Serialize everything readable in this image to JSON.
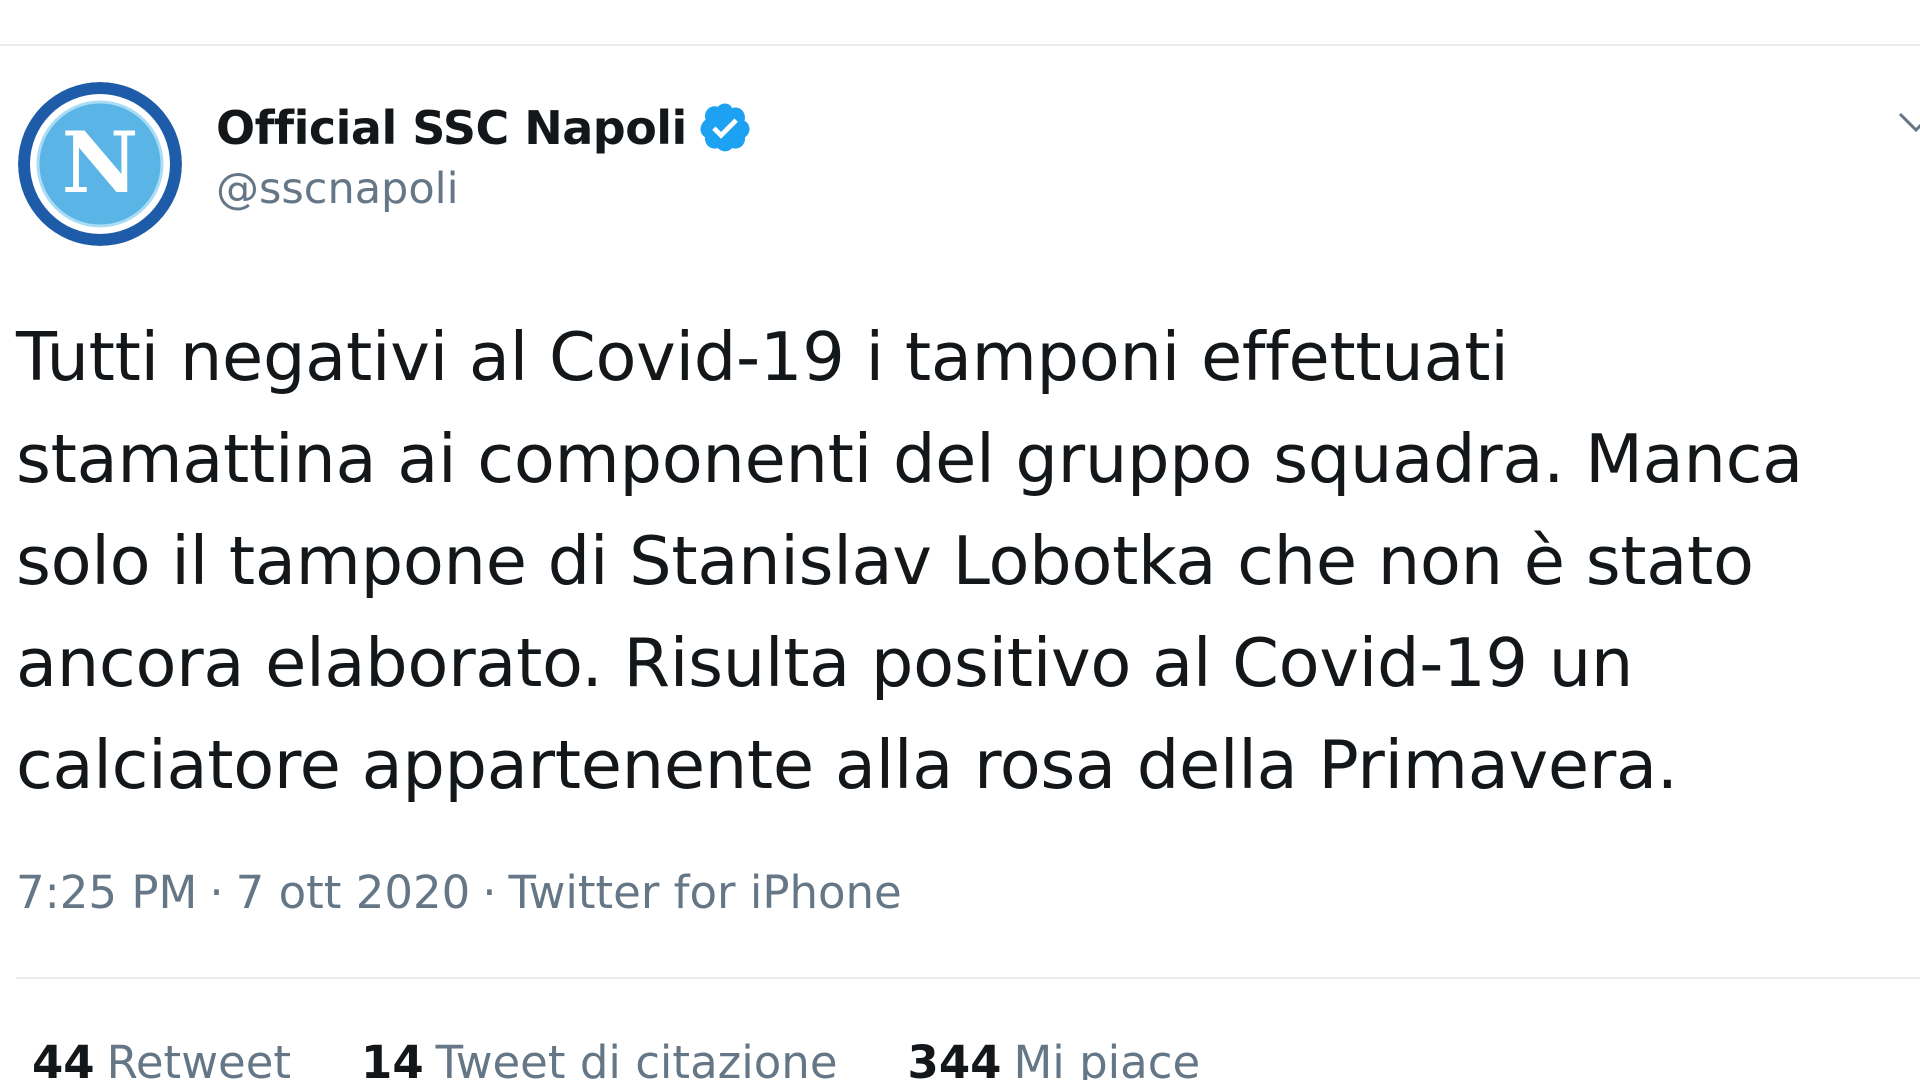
{
  "tweet": {
    "author": {
      "display_name": "Official SSC Napoli",
      "handle": "@sscnapoli",
      "verified": true,
      "avatar_icon": "napoli-crest-icon",
      "avatar_letter": "N"
    },
    "text": "Tutti negativi al Covid-19 i tamponi effettuati\nstamattina ai componenti del gruppo squadra. Manca\nsolo il tampone di Stanislav Lobotka che non è stato\nancora elaborato. Risulta positivo al Covid-19 un\ncalciatore appartenente alla rosa della Primavera.",
    "meta": {
      "time": "7:25 PM",
      "separator": "·",
      "date": "7 ott 2020",
      "source": "Twitter for iPhone"
    },
    "stats": {
      "retweets": {
        "count": "44",
        "label": "Retweet"
      },
      "quotes": {
        "count": "14",
        "label": "Tweet di citazione"
      },
      "likes": {
        "count": "344",
        "label": "Mi piace"
      }
    }
  },
  "colors": {
    "text_primary": "#14171a",
    "text_secondary": "#657786",
    "verified_blue": "#1da1f2",
    "divider": "#e6ecf0",
    "napoli_blue": "#1e5ba8",
    "napoli_light_blue": "#5ab4e5"
  },
  "icons": {
    "verified": "verified-badge-icon",
    "menu": "chevron-down-icon"
  }
}
